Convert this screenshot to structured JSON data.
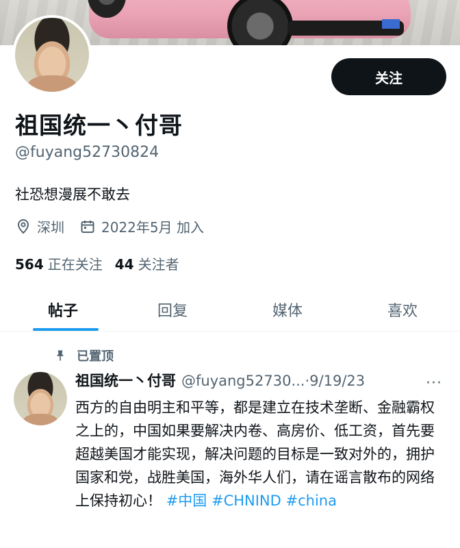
{
  "profile": {
    "follow_button": "关注",
    "display_name": "祖国统一丶付哥",
    "handle": "@fuyang52730824",
    "bio": "社恐想漫展不敢去",
    "location": "深圳",
    "joined": "2022年5月 加入",
    "following_count": "564",
    "following_label": "正在关注",
    "followers_count": "44",
    "followers_label": "关注者"
  },
  "tabs": [
    {
      "label": "帖子"
    },
    {
      "label": "回复"
    },
    {
      "label": "媒体"
    },
    {
      "label": "喜欢"
    }
  ],
  "post": {
    "pinned_label": "已置顶",
    "author_name": "祖国统一丶付哥",
    "author_handle": "@fuyang52730...",
    "separator": "·",
    "date": "9/19/23",
    "more": "···",
    "text": "西方的自由明主和平等，都是建立在技术垄断、金融霸权之上的，中国如果要解决内卷、高房价、低工资，首先要超越美国才能实现，解决问题的目标是一致对外的，拥护国家和党，战胜美国，海外华人们，请在谣言散布的网络上保持初心！",
    "hashtags": [
      "#中国",
      "#CHNIND",
      "#china"
    ]
  },
  "icons": {
    "location": "location-pin-icon",
    "calendar": "calendar-icon",
    "pin": "pin-icon",
    "more": "more-icon"
  },
  "colors": {
    "accent": "#1d9bf0",
    "text": "#0f1419",
    "secondary": "#536471",
    "button_bg": "#0f1419"
  }
}
